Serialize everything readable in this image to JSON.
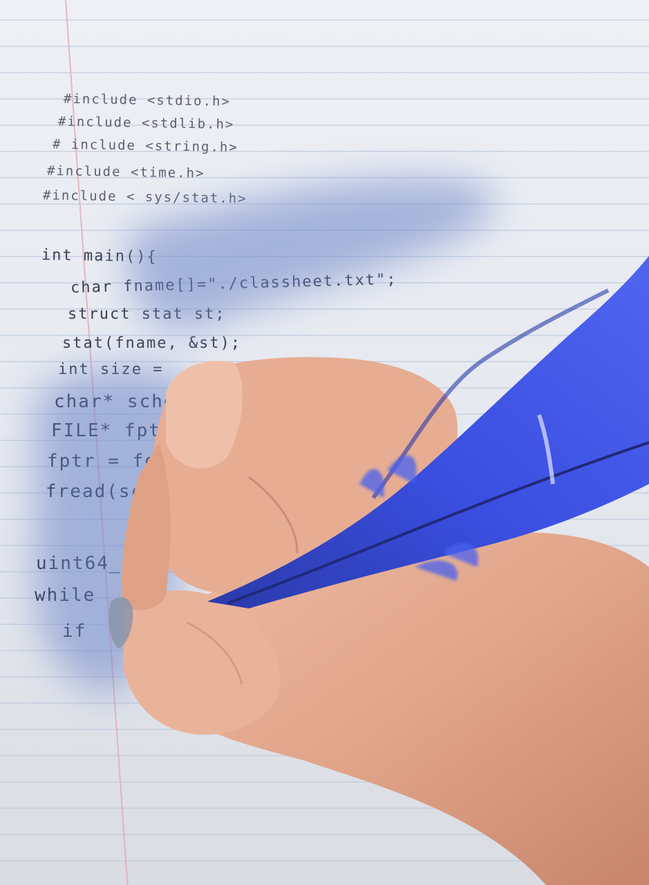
{
  "photo": {
    "subject": "hand-holding-blue-feather-quill",
    "colors": {
      "paper": "#e7eaf1",
      "rule": "#b8c9dd",
      "margin": "#e3a9b3",
      "ink": "#2f3345",
      "feather": "#3a4ee0",
      "skin": "#e3a98f"
    }
  },
  "code_lines": [
    "#include <stdio.h>",
    "#include <stdlib.h>",
    "# include <string.h>",
    "#include <time.h>",
    "#include < sys/stat.h>",
    "int main(){",
    "char fname[]=\"./classheet.txt\";",
    "struct stat st;",
    "stat(fname, &st);",
    "int size =",
    "char* sche",
    "FILE* fpt",
    "fptr = fop",
    "fread(sche",
    "uint64_t",
    "while",
    "if"
  ]
}
